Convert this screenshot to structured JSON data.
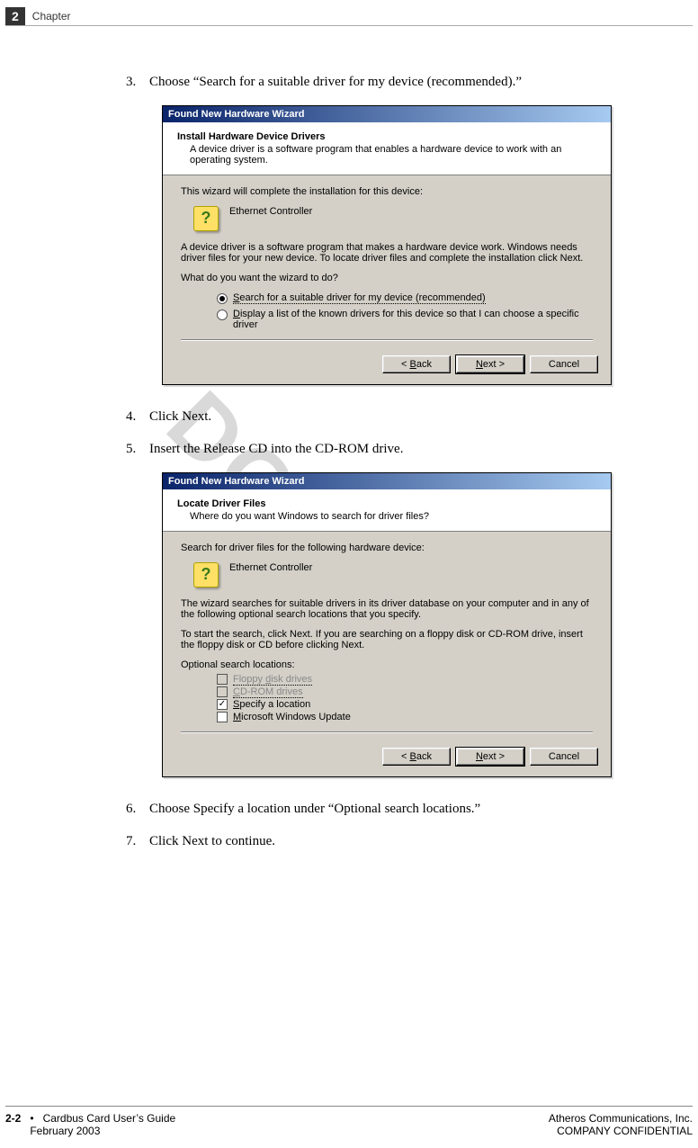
{
  "header": {
    "chapter_num": "2",
    "chapter_label": "Chapter"
  },
  "watermark": "DO NOT C",
  "steps": {
    "s3": {
      "num": "3.",
      "text": "Choose “Search for a suitable driver for my device (recommended).”"
    },
    "s4": {
      "num": "4.",
      "text": "Click Next."
    },
    "s5": {
      "num": "5.",
      "text": "Insert the Release CD into the CD-ROM drive."
    },
    "s6": {
      "num": "6.",
      "text": "Choose Specify a location under “Optional search locations.”"
    },
    "s7": {
      "num": "7.",
      "text": "Click Next to continue."
    }
  },
  "dialog1": {
    "title": "Found New Hardware Wizard",
    "panel_title": "Install Hardware Device Drivers",
    "panel_sub": "A device driver is a software program that enables a hardware device to work with an operating system.",
    "line1": "This wizard will complete the installation for this device:",
    "device": "Ethernet Controller",
    "line2": "A device driver is a software program that makes a hardware device work. Windows needs driver files for your new device. To locate driver files and complete the installation click Next.",
    "line3": "What do you want the wizard to do?",
    "opt1": "Search for a suitable driver for my device (recommended)",
    "opt2": "Display a list of the known drivers for this device so that I can choose a specific driver",
    "btn_back": "< Back",
    "btn_next": "Next >",
    "btn_cancel": "Cancel"
  },
  "dialog2": {
    "title": "Found New Hardware Wizard",
    "panel_title": "Locate Driver Files",
    "panel_sub": "Where do you want Windows to search for driver files?",
    "line1": "Search for driver files for the following hardware device:",
    "device": "Ethernet Controller",
    "line2": "The wizard searches for suitable drivers in its driver database on your computer and in any of the following optional search locations that you specify.",
    "line3": "To start the search, click Next. If you are searching on a floppy disk or CD-ROM drive, insert the floppy disk or CD before clicking Next.",
    "line4": "Optional search locations:",
    "chk1": "Floppy disk drives",
    "chk2": "CD-ROM drives",
    "chk3": "Specify a location",
    "chk4": "Microsoft Windows Update",
    "btn_back": "< Back",
    "btn_next": "Next >",
    "btn_cancel": "Cancel"
  },
  "footer": {
    "page": "2-2",
    "bullet": "•",
    "title": "Cardbus Card User’s Guide",
    "date": "February 2003",
    "company": "Atheros Communications, Inc.",
    "conf": "COMPANY CONFIDENTIAL"
  }
}
